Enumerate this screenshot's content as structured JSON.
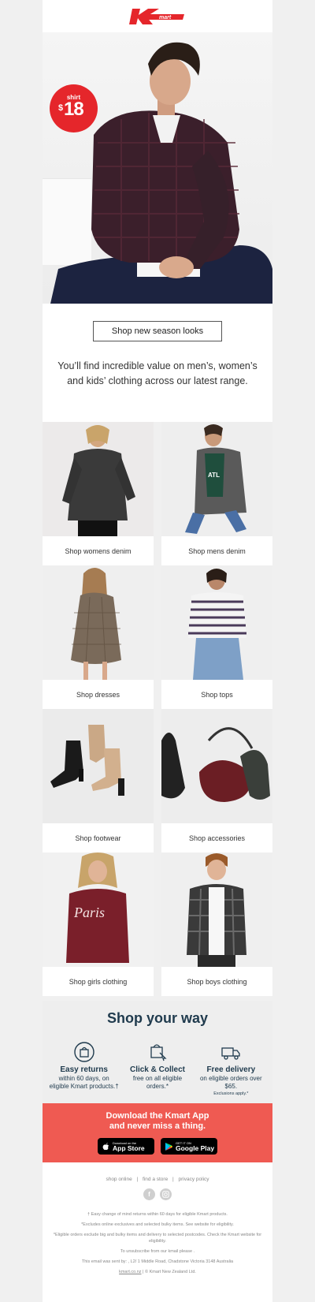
{
  "brand": {
    "logo_text": "Kmart",
    "color": "#e5262b"
  },
  "hero": {
    "badge_label": "shirt",
    "badge_currency": "$",
    "badge_amount": "18",
    "badge_color": "#e5262b"
  },
  "cta": {
    "label": "Shop new season looks"
  },
  "intro": {
    "text": "You’ll find incredible value on men’s, women’s and kids’ clothing across our latest range."
  },
  "categories": [
    {
      "label": "Shop womens denim",
      "image": "womens-denim-photo"
    },
    {
      "label": "Shop mens denim",
      "image": "mens-denim-photo"
    },
    {
      "label": "Shop dresses",
      "image": "dress-photo"
    },
    {
      "label": "Shop tops",
      "image": "tops-photo"
    },
    {
      "label": "Shop footwear",
      "image": "boots-photo"
    },
    {
      "label": "Shop accessories",
      "image": "bags-photo"
    },
    {
      "label": "Shop girls clothing",
      "image": "girls-photo"
    },
    {
      "label": "Shop boys clothing",
      "image": "boys-photo"
    }
  ],
  "shop_your_way": {
    "title": "Shop your way",
    "benefits": [
      {
        "icon": "return-bag-icon",
        "title": "Easy returns",
        "desc": "within 60 days, on eligible Kmart products.†",
        "small": ""
      },
      {
        "icon": "click-collect-icon",
        "title": "Click & Collect",
        "desc": "free on all eligible orders.*",
        "small": ""
      },
      {
        "icon": "delivery-truck-icon",
        "title": "Free delivery",
        "desc": "on eligible orders over $65.",
        "small": "Exclusions apply.*"
      }
    ]
  },
  "app": {
    "headline_1": "Download the Kmart App",
    "headline_2": "and never miss a thing.",
    "appstore_small": "Download on the",
    "appstore_big": "App Store",
    "googleplay_small": "GET IT ON",
    "googleplay_big": "Google Play",
    "bg_color": "#ef5a52"
  },
  "footer": {
    "link_1": "shop online",
    "link_2": "find a store",
    "link_3": "privacy policy",
    "sep": "|",
    "fine_1": "† Easy change of mind returns within 60 days for eligible Kmart products.",
    "fine_2": "*Excludes online exclusives and selected bulky items. See website for eligibility.",
    "fine_3": "*Eligible orders exclude big and bulky items and delivery to selected postcodes. Check the Kmart website for eligibility.",
    "fine_4": "To unsubscribe from our kmail please .",
    "fine_5": "This email was sent by: , L2/ 1 Middle Road, Chadstone Victoria 3148 Australia",
    "fine_6_link": "kmart.co.nz",
    "fine_6_rest": " | © Kmart New Zealand Ltd."
  }
}
